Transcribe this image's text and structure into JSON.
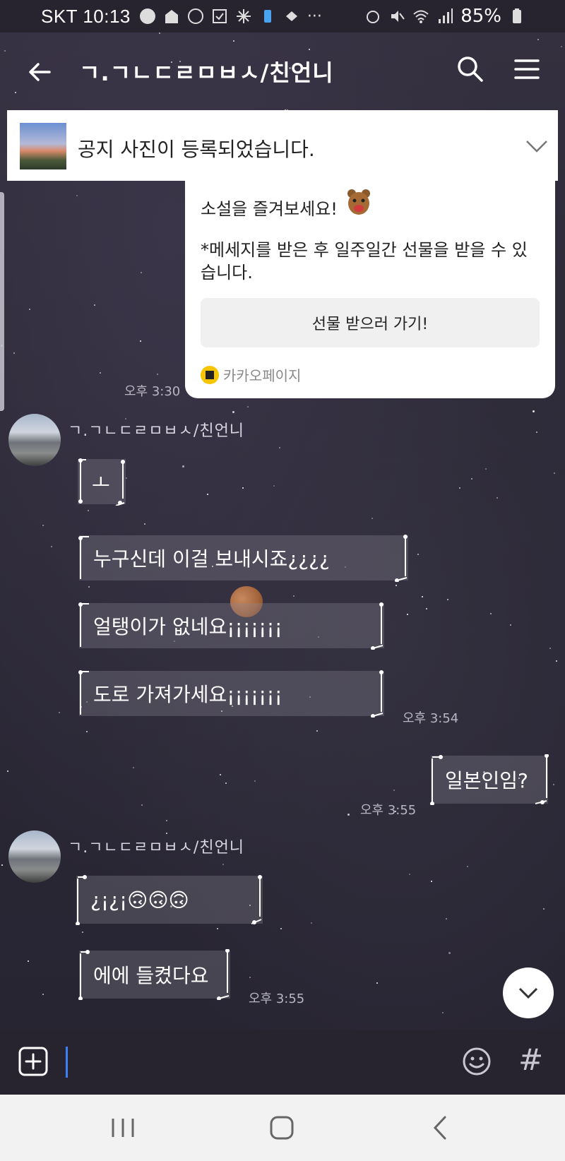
{
  "status_bar": {
    "carrier_time": "SKT 10:13",
    "battery": "85%"
  },
  "header": {
    "title": "ㄱ.ㄱㄴㄷㄹㅁㅂㅅ/친언니"
  },
  "notice": {
    "text": "공지 사진이 등록되었습니다."
  },
  "promo": {
    "line1": "소설을 즐겨보세요!",
    "line2": "*메세지를 받은 후 일주일간 선물을 받을 수 있습니다.",
    "button": "선물 받으러 가기!",
    "brand": "카카오페이지",
    "time": "오후 3:30"
  },
  "messages": {
    "group1": {
      "sender": "ㄱ.ㄱㄴㄷㄹㅁㅂㅅ/친언니",
      "m1": "ㅗ",
      "m2": "누구신데 이걸 보내시죠¿¿¿¿",
      "m3": "얼탱이가 없네요¡¡¡¡¡¡¡",
      "m4": "도로 가져가세요¡¡¡¡¡¡¡",
      "time": "오후 3:54"
    },
    "mine": {
      "m1": "일본인임?",
      "time": "오후 3:55"
    },
    "group2": {
      "sender": "ㄱ.ㄱㄴㄷㄹㅁㅂㅅ/친언니",
      "m1": "¿¡¿¡🙃🙃🙃",
      "m2": "에에 들켰다요",
      "time": "오후 3:55"
    }
  },
  "input": {
    "placeholder": ""
  },
  "icons": {
    "back": "arrow-left-icon",
    "search": "search-icon",
    "menu": "hamburger-menu-icon",
    "notice_toggle": "chevron-down-icon",
    "plus": "plus-square-icon",
    "emoji": "smiley-icon",
    "hash": "#"
  }
}
